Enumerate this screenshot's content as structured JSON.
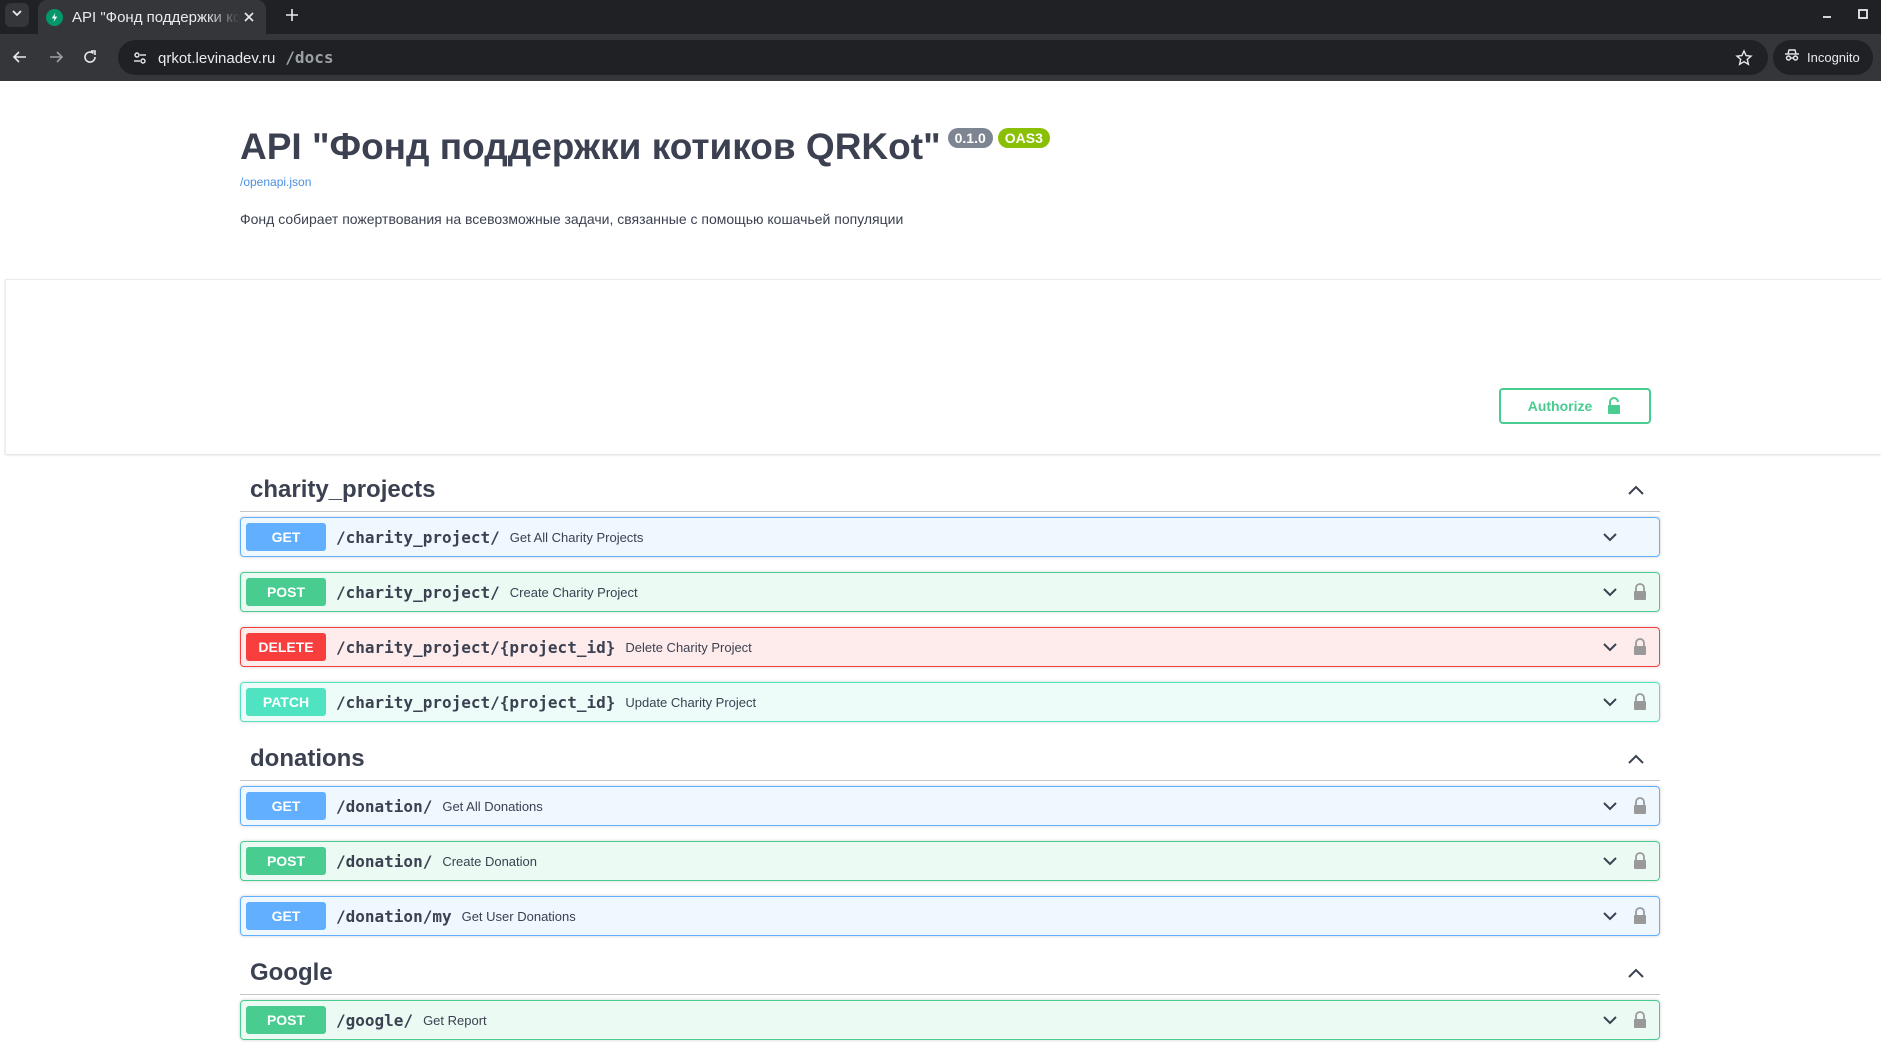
{
  "browser": {
    "tab_title": "API \"Фонд поддержки котиков QRKot\"",
    "url_host": "qrkot.levinadev.ru",
    "url_path": "/docs",
    "incognito_label": "Incognito",
    "icons": {
      "tab_search": "chevron-down-icon",
      "favicon": "fastapi-favicon",
      "close": "close-icon",
      "new_tab": "plus-icon",
      "back": "arrow-left-icon",
      "forward": "arrow-right-icon",
      "reload": "reload-icon",
      "site_info": "tune-icon",
      "bookmark": "star-icon",
      "incognito": "incognito-icon"
    }
  },
  "info": {
    "title": "API \"Фонд поддержки котиков QRKot\"",
    "version": "0.1.0",
    "oas": "OAS3",
    "spec_link": "/openapi.json",
    "description": "Фонд собирает пожертвования на всевозможные задачи, связанные с помощью кошачьей популяции"
  },
  "authorize": {
    "label": "Authorize"
  },
  "colors": {
    "get": "#61affe",
    "post": "#49cc90",
    "delete": "#f93e3e",
    "patch": "#50e3c2",
    "version_badge": "#7d8492",
    "oas_badge": "#89bf04"
  },
  "tags": [
    {
      "name": "charity_projects",
      "operations": [
        {
          "method": "GET",
          "path": "/charity_project/",
          "summary": "Get All Charity Projects",
          "locked": false,
          "open": true
        },
        {
          "method": "POST",
          "path": "/charity_project/",
          "summary": "Create Charity Project",
          "locked": true
        },
        {
          "method": "DELETE",
          "path": "/charity_project/{project_id}",
          "summary": "Delete Charity Project",
          "locked": true
        },
        {
          "method": "PATCH",
          "path": "/charity_project/{project_id}",
          "summary": "Update Charity Project",
          "locked": true
        }
      ]
    },
    {
      "name": "donations",
      "operations": [
        {
          "method": "GET",
          "path": "/donation/",
          "summary": "Get All Donations",
          "locked": true
        },
        {
          "method": "POST",
          "path": "/donation/",
          "summary": "Create Donation",
          "locked": true
        },
        {
          "method": "GET",
          "path": "/donation/my",
          "summary": "Get User Donations",
          "locked": true
        }
      ]
    },
    {
      "name": "Google",
      "operations": [
        {
          "method": "POST",
          "path": "/google/",
          "summary": "Get Report",
          "locked": true
        }
      ]
    }
  ]
}
